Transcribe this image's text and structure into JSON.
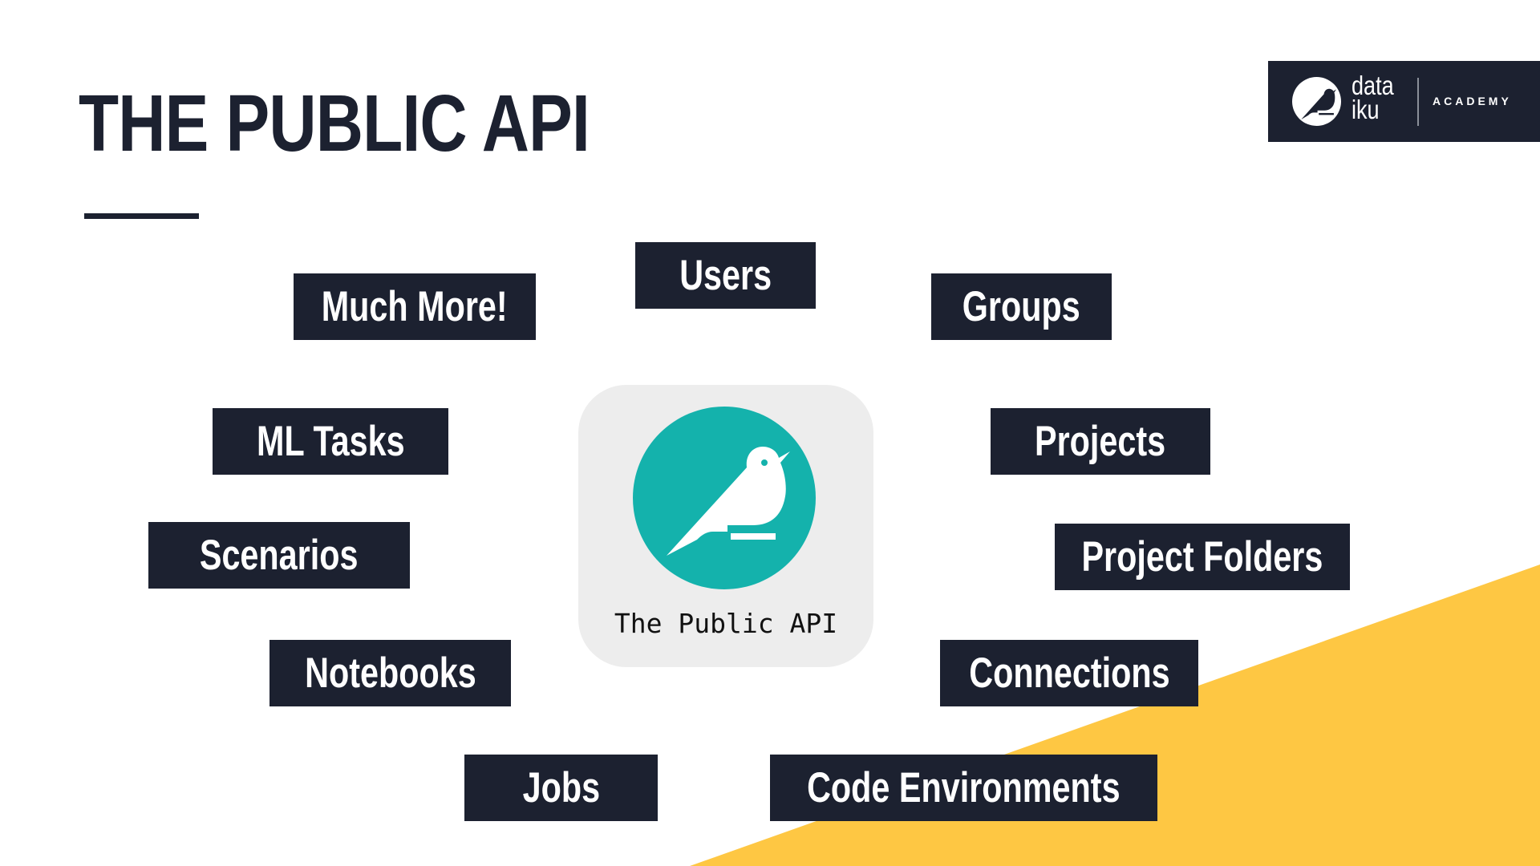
{
  "slide": {
    "title": "THE PUBLIC API",
    "colors": {
      "navy": "#1c2130",
      "accent_yellow": "#fec743",
      "teal": "#14b2ac",
      "card_gray": "#ededed"
    }
  },
  "logo": {
    "icon": "dataiku-bird-icon",
    "word_line1": "data",
    "word_line2": "iku",
    "subtitle": "ACADEMY"
  },
  "center_card": {
    "icon": "dataiku-bird-icon",
    "caption": "The Public API"
  },
  "tags": [
    {
      "label": "Users"
    },
    {
      "label": "Much More!"
    },
    {
      "label": "Groups"
    },
    {
      "label": "ML Tasks"
    },
    {
      "label": "Projects"
    },
    {
      "label": "Scenarios"
    },
    {
      "label": "Project Folders"
    },
    {
      "label": "Notebooks"
    },
    {
      "label": "Connections"
    },
    {
      "label": "Jobs"
    },
    {
      "label": "Code Environments"
    }
  ]
}
